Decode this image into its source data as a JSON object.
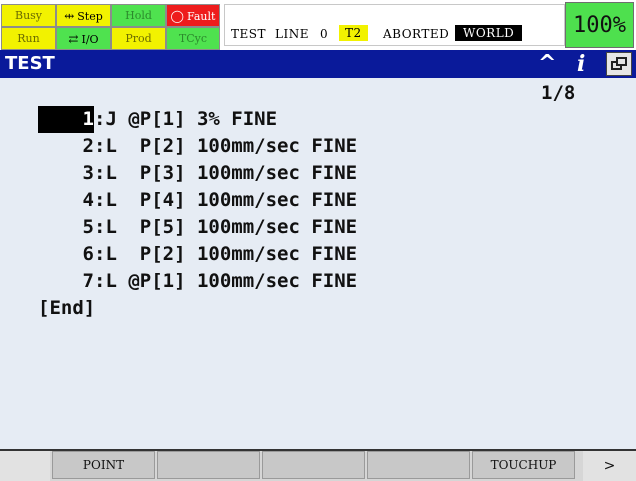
{
  "status": {
    "leds": [
      {
        "label": "Busy",
        "color": "yellow",
        "on": false
      },
      {
        "label": "Step",
        "color": "yellow",
        "on": true,
        "icon": "step-icon"
      },
      {
        "label": "Hold",
        "color": "green",
        "on": false
      },
      {
        "label": "Fault",
        "color": "red",
        "on": true,
        "icon": "fault-icon"
      },
      {
        "label": "Run",
        "color": "yellow",
        "on": false
      },
      {
        "label": "I/O",
        "color": "green",
        "on": true,
        "icon": "io-icon"
      },
      {
        "label": "Prod",
        "color": "yellow",
        "on": false
      },
      {
        "label": "TCyc",
        "color": "green",
        "on": false
      }
    ],
    "program": "TEST",
    "line_label": "LINE",
    "line_number": "0",
    "mode": "T2",
    "state": "ABORTED",
    "frame": "WORLD",
    "override": "100%"
  },
  "title": {
    "text": "TEST",
    "up_glyph": "^",
    "info_glyph": "i"
  },
  "editor": {
    "page": "1/8",
    "cursor_line": 1,
    "lines": [
      {
        "num": "1",
        "instr": ":J @P[1] 3% FINE"
      },
      {
        "num": "2",
        "instr": ":L  P[2] 100mm/sec FINE"
      },
      {
        "num": "3",
        "instr": ":L  P[3] 100mm/sec FINE"
      },
      {
        "num": "4",
        "instr": ":L  P[4] 100mm/sec FINE"
      },
      {
        "num": "5",
        "instr": ":L  P[5] 100mm/sec FINE"
      },
      {
        "num": "6",
        "instr": ":L  P[2] 100mm/sec FINE"
      },
      {
        "num": "7",
        "instr": ":L @P[1] 100mm/sec FINE"
      }
    ],
    "end_marker": "[End]"
  },
  "fkeys": [
    "POINT",
    "",
    "",
    "",
    "TOUCHUP"
  ],
  "next_label": ">",
  "colors": {
    "title_bar": "#0a1a9a",
    "led_yellow": "#f2f200",
    "led_green": "#4fe24f",
    "led_red": "#ee1c1c",
    "override": "#4ee04e",
    "background": "#e6ecf4"
  }
}
